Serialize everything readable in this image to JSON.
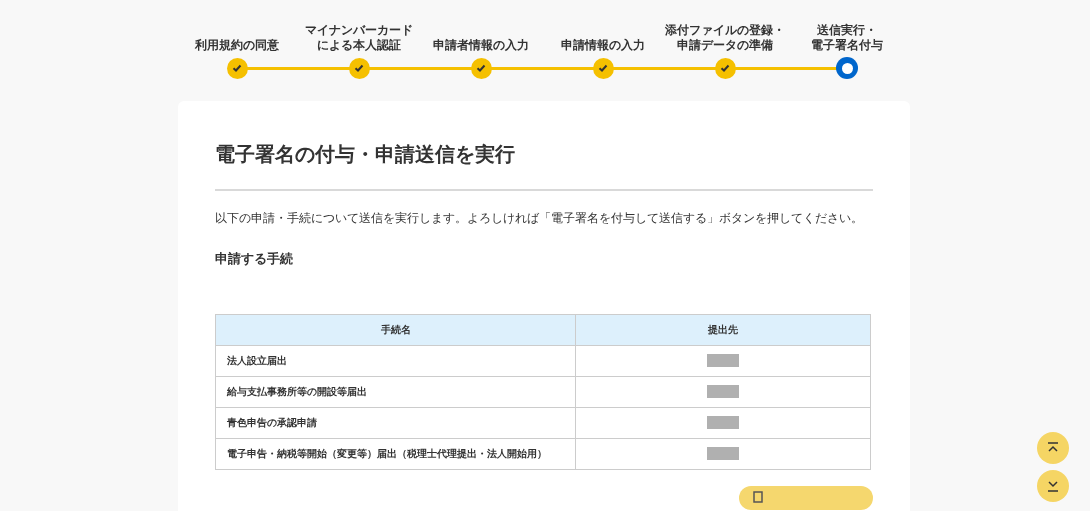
{
  "steps": [
    {
      "lines": [
        "利用規約の同意"
      ],
      "done": true
    },
    {
      "lines": [
        "マイナンバーカード",
        "による本人認証"
      ],
      "done": true
    },
    {
      "lines": [
        "申請者情報の入力"
      ],
      "done": true
    },
    {
      "lines": [
        "申請情報の入力"
      ],
      "done": true
    },
    {
      "lines": [
        "添付ファイルの登録・",
        "申請データの準備"
      ],
      "done": true
    },
    {
      "lines": [
        "送信実行・",
        "電子署名付与"
      ],
      "done": false
    }
  ],
  "title": "電子署名の付与・申請送信を実行",
  "intro": "以下の申請・手続について送信を実行します。よろしければ「電子署名を付与して送信する」ボタンを押してください。",
  "section_heading": "申請する手続",
  "table": {
    "columns": [
      "手続名",
      "提出先"
    ],
    "rows": [
      {
        "name": "法人設立届出",
        "redacted": true
      },
      {
        "name": "給与支払事務所等の開設等届出",
        "redacted": true
      },
      {
        "name": "青色申告の承認申請",
        "redacted": true
      },
      {
        "name": "電子申告・納税等開始（変更等）届出（税理士代理提出・法人開始用）",
        "redacted": true
      }
    ]
  }
}
